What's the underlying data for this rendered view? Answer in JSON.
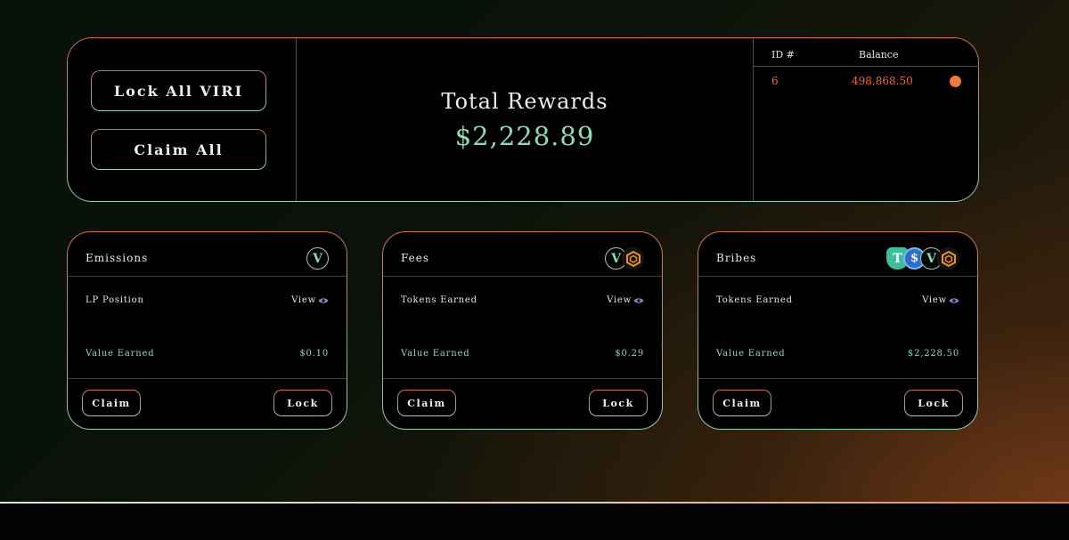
{
  "actions": {
    "lock_all_label": "Lock All VIRI",
    "claim_all_label": "Claim All"
  },
  "summary": {
    "title": "Total Rewards",
    "value": "$2,228.89"
  },
  "veNFT_table": {
    "headers": [
      "ID #",
      "Balance"
    ],
    "rows": [
      {
        "id": "6",
        "balance": "498,868.50",
        "selected": true
      }
    ],
    "accent_color": "#f07a3e"
  },
  "cards": [
    {
      "title": "Emissions",
      "token_icons": [
        "viri-icon"
      ],
      "row1_label": "LP Position",
      "row1_link": "View",
      "row2_label": "Value Earned",
      "row2_value": "$0.10",
      "claim_label": "Claim",
      "lock_label": "Lock"
    },
    {
      "title": "Fees",
      "token_icons": [
        "viri-icon",
        "hex-token-icon"
      ],
      "row1_label": "Tokens Earned",
      "row1_link": "View",
      "row2_label": "Value Earned",
      "row2_value": "$0.29",
      "claim_label": "Claim",
      "lock_label": "Lock"
    },
    {
      "title": "Bribes",
      "token_icons": [
        "usdt-icon",
        "usdc-icon",
        "viri-icon",
        "hex-token-icon"
      ],
      "row1_label": "Tokens Earned",
      "row1_link": "View",
      "row2_label": "Value Earned",
      "row2_value": "$2,228.50",
      "claim_label": "Claim",
      "lock_label": "Lock"
    }
  ],
  "icons": {
    "viri": "V",
    "usdt": "T",
    "usdc": "$"
  },
  "colors": {
    "accent_green": "#8fd9b4",
    "accent_orange": "#f07a3e"
  }
}
